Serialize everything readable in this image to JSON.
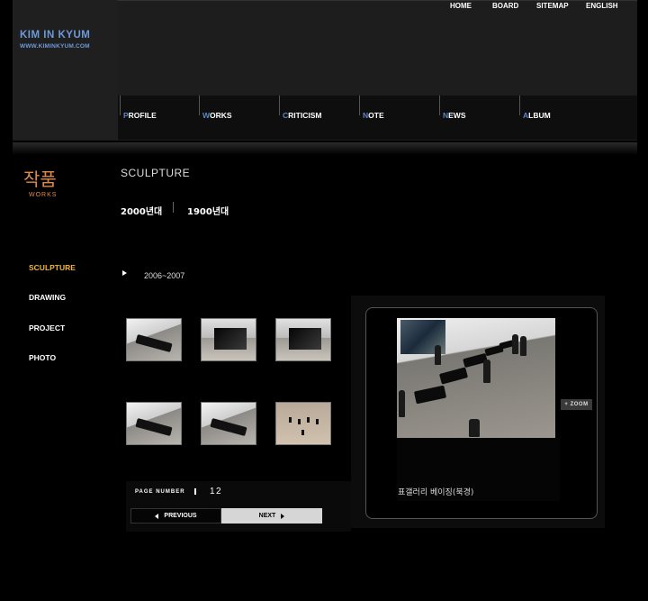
{
  "brand": {
    "name": "KIM IN KYUM",
    "url": "WWW.KIMINKYUM.COM"
  },
  "utility_nav": [
    "HOME",
    "BOARD",
    "SITEMAP",
    "ENGLISH"
  ],
  "main_nav": [
    {
      "first": "P",
      "rest": "ROFILE"
    },
    {
      "first": "W",
      "rest": "ORKS"
    },
    {
      "first": "C",
      "rest": "RITICISM"
    },
    {
      "first": "N",
      "rest": "OTE"
    },
    {
      "first": "N",
      "rest": "EWS"
    },
    {
      "first": "A",
      "rest": "LBUM"
    }
  ],
  "section": {
    "korean": "작품",
    "english": "WORKS"
  },
  "sidebar": {
    "items": [
      "SCULPTURE",
      "DRAWING",
      "PROJECT",
      "PHOTO"
    ],
    "active": "SCULPTURE"
  },
  "content": {
    "title": "SCULPTURE",
    "eras": [
      "2000년대",
      "1900년대"
    ],
    "period": "2006~2007"
  },
  "pager": {
    "label": "PAGE NUMBER",
    "pages": [
      "1",
      "2"
    ],
    "previous": "PREVIOUS",
    "next": "NEXT"
  },
  "viewer": {
    "caption": "표갤러리 베이징(북경)",
    "zoom": "+ ZOOM"
  },
  "colors": {
    "brand": "#6d9ad8",
    "active_menu": "#f0b43a",
    "korean_title": "#e08a4a",
    "background": "#000000"
  }
}
